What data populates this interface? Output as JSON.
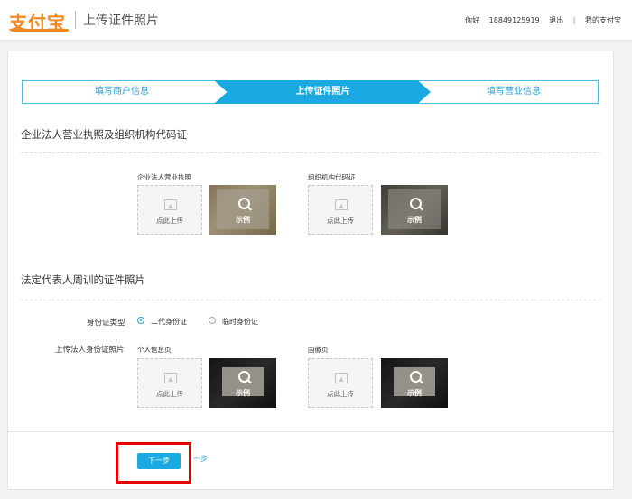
{
  "header": {
    "logo_text": "支付宝",
    "title": "上传证件照片",
    "greeting": "你好",
    "phone": "18849125919",
    "logout": "退出",
    "divider": "|",
    "my_alipay": "我的支付宝"
  },
  "steps": [
    "填写商户信息",
    "上传证件照片",
    "填写营业信息"
  ],
  "section1": {
    "title": "企业法人营业执照及组织机构代码证",
    "items": [
      {
        "label": "企业法人营业执照",
        "upload_text": "点此上传",
        "example_text": "示例"
      },
      {
        "label": "组织机构代码证",
        "upload_text": "点此上传",
        "example_text": "示例"
      }
    ]
  },
  "section2": {
    "title": "法定代表人周训的证件照片",
    "id_type_label": "身份证类型",
    "id_options": [
      {
        "label": "二代身份证",
        "selected": true
      },
      {
        "label": "临时身份证",
        "selected": false
      }
    ],
    "upload_label": "上传法人身份证照片",
    "items": [
      {
        "label": "个人信息页",
        "upload_text": "点此上传",
        "example_text": "示例"
      },
      {
        "label": "国徽页",
        "upload_text": "点此上传",
        "example_text": "示例"
      }
    ]
  },
  "footer": {
    "next_button": "下一步",
    "next_suffix": "一步"
  },
  "colors": {
    "accent": "#1aa9e1",
    "link": "#2a9fd6",
    "brand": "#f08a24",
    "highlight": "#e60000"
  }
}
